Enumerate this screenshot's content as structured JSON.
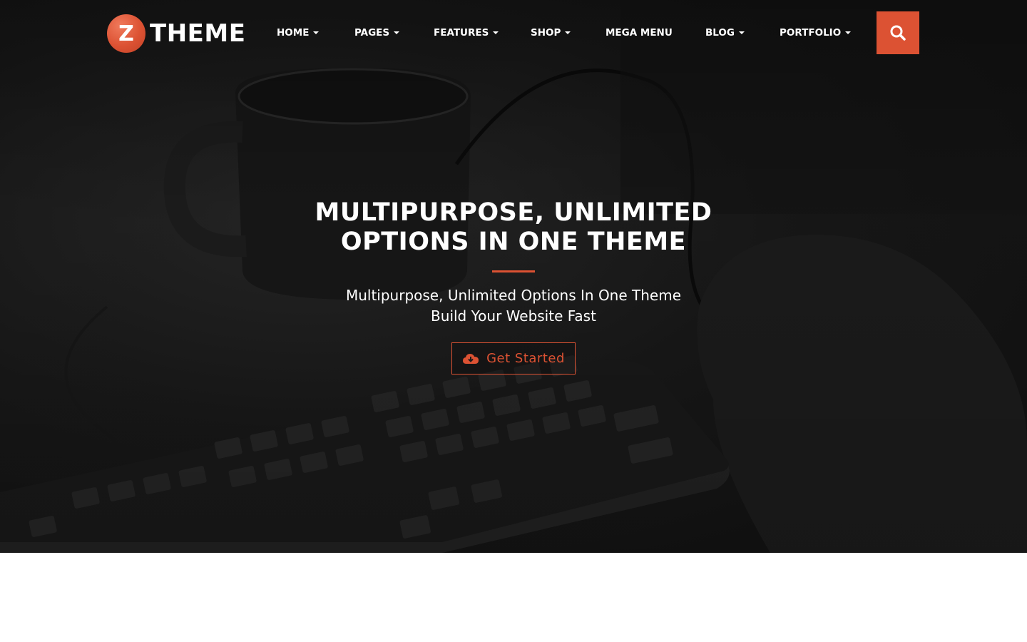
{
  "brand": {
    "badge_letter": "Z",
    "name": "THEME",
    "accent_color": "#dc5233"
  },
  "nav": {
    "items": [
      {
        "label": "HOME",
        "has_dropdown": true
      },
      {
        "label": "PAGES",
        "has_dropdown": true
      },
      {
        "label": "FEATURES",
        "has_dropdown": true
      },
      {
        "label": "SHOP",
        "has_dropdown": true
      },
      {
        "label": "MEGA MENU",
        "has_dropdown": false
      },
      {
        "label": "BLOG",
        "has_dropdown": true
      },
      {
        "label": "PORTFOLIO",
        "has_dropdown": true
      }
    ],
    "search_icon": "search-icon"
  },
  "hero": {
    "title_line1": "MULTIPURPOSE, UNLIMITED",
    "title_line2": "OPTIONS IN ONE THEME",
    "subtitle_line1": "Multipurpose, Unlimited Options In One Theme",
    "subtitle_line2": "Build Your Website Fast",
    "cta_label": "Get Started",
    "cta_icon": "cloud-download-icon",
    "background_image": "desk-with-mug-keyboard-and-hand"
  }
}
